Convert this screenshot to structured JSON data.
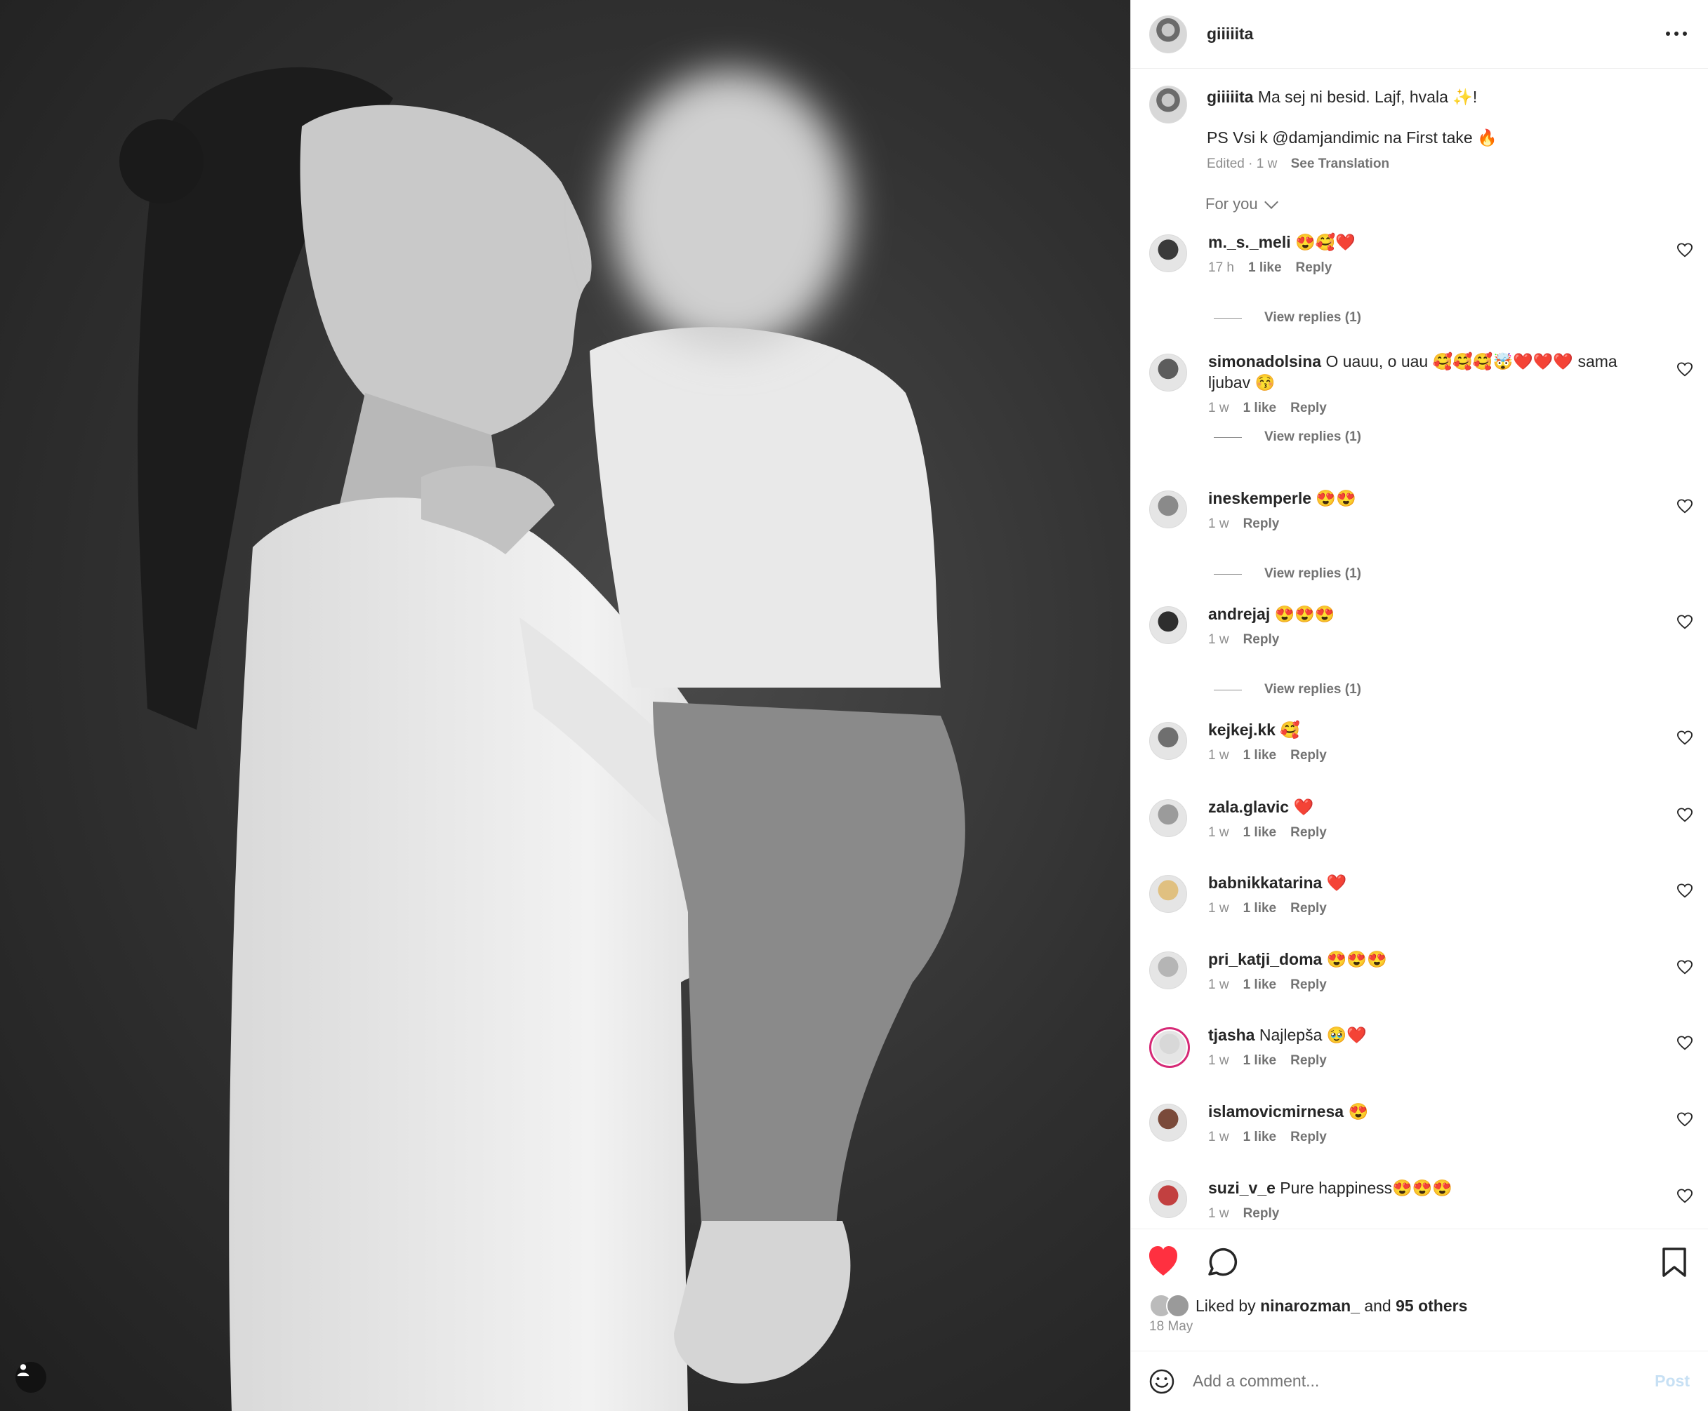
{
  "post": {
    "author": "giiiiita",
    "caption_text": "Ma sej ni besid. Lajf, hvala ✨!",
    "caption_line2": "PS Vsi k @damjandimic na First take 🔥",
    "caption_meta": "Edited · 1 w",
    "see_translation": "See Translation"
  },
  "comments_filter": "For you",
  "comments": [
    {
      "user": "m._s._meli",
      "text": "😍🥰❤️",
      "time": "17 h",
      "likes": "1 like",
      "reply": "Reply",
      "view_replies": "View replies (1)"
    },
    {
      "user": "simonadolsina",
      "text": "O uauu, o uau 🥰🥰🥰🤯❤️❤️❤️ sama ljubav 😚",
      "time": "1 w",
      "likes": "1 like",
      "reply": "Reply",
      "view_replies": "View replies (1)"
    },
    {
      "user": "ineskemperle",
      "text": "😍😍",
      "time": "1 w",
      "likes": "",
      "reply": "Reply",
      "view_replies": "View replies (1)"
    },
    {
      "user": "andrejaj",
      "text": "😍😍😍",
      "time": "1 w",
      "likes": "",
      "reply": "Reply",
      "view_replies": "View replies (1)"
    },
    {
      "user": "kejkej.kk",
      "text": "🥰",
      "time": "1 w",
      "likes": "1 like",
      "reply": "Reply"
    },
    {
      "user": "zala.glavic",
      "text": "❤️",
      "time": "1 w",
      "likes": "1 like",
      "reply": "Reply"
    },
    {
      "user": "babnikkatarina",
      "text": "❤️",
      "time": "1 w",
      "likes": "1 like",
      "reply": "Reply"
    },
    {
      "user": "pri_katji_doma",
      "text": "😍😍😍",
      "time": "1 w",
      "likes": "1 like",
      "reply": "Reply"
    },
    {
      "user": "tjasha",
      "text": "Najlepša 🥹❤️",
      "time": "1 w",
      "likes": "1 like",
      "reply": "Reply"
    },
    {
      "user": "islamovicmirnesa",
      "text": "😍",
      "time": "1 w",
      "likes": "1 like",
      "reply": "Reply"
    },
    {
      "user": "suzi_v_e",
      "text": "Pure happiness😍😍😍",
      "time": "1 w",
      "likes": "",
      "reply": "Reply"
    }
  ],
  "likes_summary": {
    "prefix": "Liked by",
    "user": "ninarozman_",
    "middle": "and",
    "others": "95 others"
  },
  "post_date": "18 May",
  "add_comment": {
    "placeholder": "Add a comment...",
    "post_label": "Post"
  },
  "icons": [
    "more-icon",
    "heart-icon",
    "comment-icon",
    "bookmark-icon",
    "emoji-icon",
    "user-tag-icon"
  ],
  "colors": {
    "liked_heart": "#ff3040",
    "post_disabled": "#c7e0f4"
  }
}
